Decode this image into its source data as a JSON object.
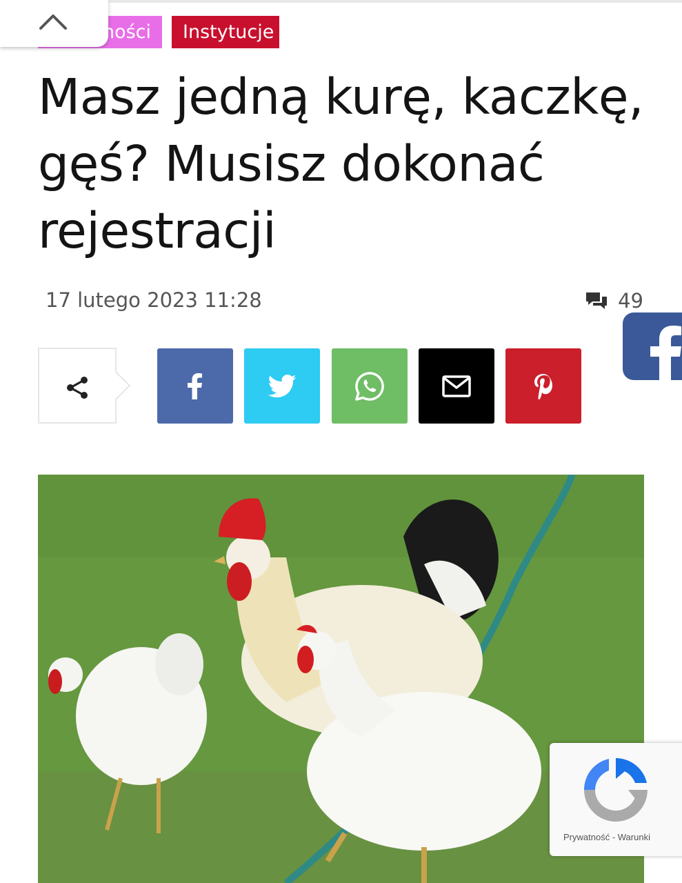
{
  "tags": {
    "first": "ności",
    "second": "Instytucje"
  },
  "article": {
    "title": "Masz jedną kurę, kaczkę, gęś? Musisz dokonać rejestracji",
    "date": "17 lutego 2023 11:28",
    "comments_count": "49"
  },
  "share": {
    "buttons": [
      {
        "network": "facebook",
        "icon": "facebook-icon",
        "color": "#4c6aaa"
      },
      {
        "network": "twitter",
        "icon": "twitter-icon",
        "color": "#2ecbf2"
      },
      {
        "network": "whatsapp",
        "icon": "whatsapp-icon",
        "color": "#6fbd65"
      },
      {
        "network": "email",
        "icon": "envelope-icon",
        "color": "#000000"
      },
      {
        "network": "pinterest",
        "icon": "pinterest-icon",
        "color": "#cb1f2b"
      }
    ]
  },
  "recaptcha": {
    "privacy": "Prywatność",
    "separator": " - ",
    "terms": "Warunki"
  },
  "colors": {
    "tag_pink": "#e86ee8",
    "tag_red": "#c8102e",
    "facebook_float": "#3b5998"
  }
}
